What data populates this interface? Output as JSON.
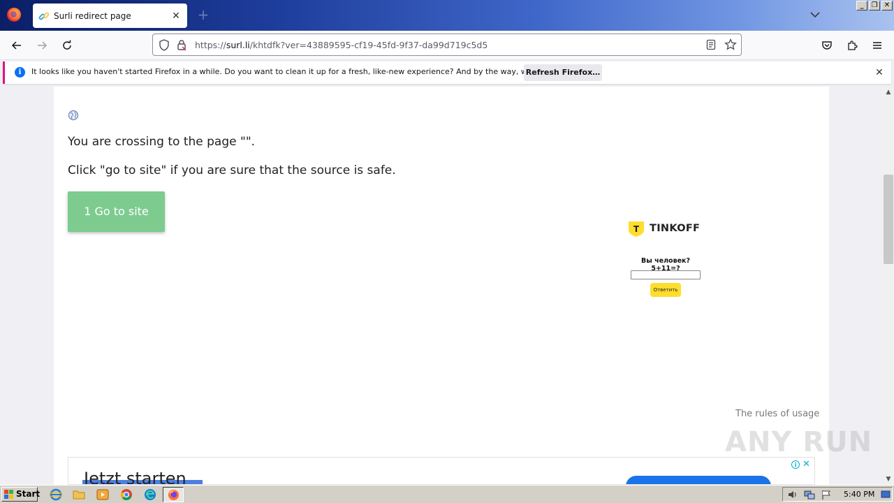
{
  "browser": {
    "tab": {
      "title": "Surli redirect page",
      "close_glyph": "✕"
    },
    "new_tab_glyph": "+",
    "window_buttons": {
      "minimize": "_",
      "restore": "❐",
      "close": "✕"
    }
  },
  "navbar": {
    "url_prefix": "https://",
    "url_domain": "surl.li",
    "url_path": "/khtdfk?ver=43889595-cf19-45fd-9f37-da99d719c5d5"
  },
  "notification": {
    "icon_glyph": "i",
    "message": "It looks like you haven't started Firefox in a while. Do you want to clean it up for a fresh, like-new experience? And by the way, welcome back!",
    "button_label": "Refresh Firefox…",
    "close_glyph": "✕"
  },
  "page": {
    "line1": "You are crossing to the page \"\".",
    "line2": "Click \"go to site\" if you are sure that the source is safe.",
    "go_button": "1 Go to site",
    "rules_link": "The rules of usage"
  },
  "tinkoff": {
    "logo_letter": "T",
    "brand": "TINKOFF",
    "question": "Вы человек? 5+11=?",
    "answer_button": "Ответить",
    "answer_value": ""
  },
  "ad": {
    "headline": "Jetzt starten",
    "info_glyph": "i",
    "close_glyph": "✕"
  },
  "watermark": "ANY RUN",
  "taskbar": {
    "start_label": "Start",
    "clock": "5:40 PM"
  },
  "colors": {
    "go_button": "#7dcb8f",
    "tinkoff_yellow": "#ffdd2d",
    "notification_accent": "#e0137d"
  }
}
